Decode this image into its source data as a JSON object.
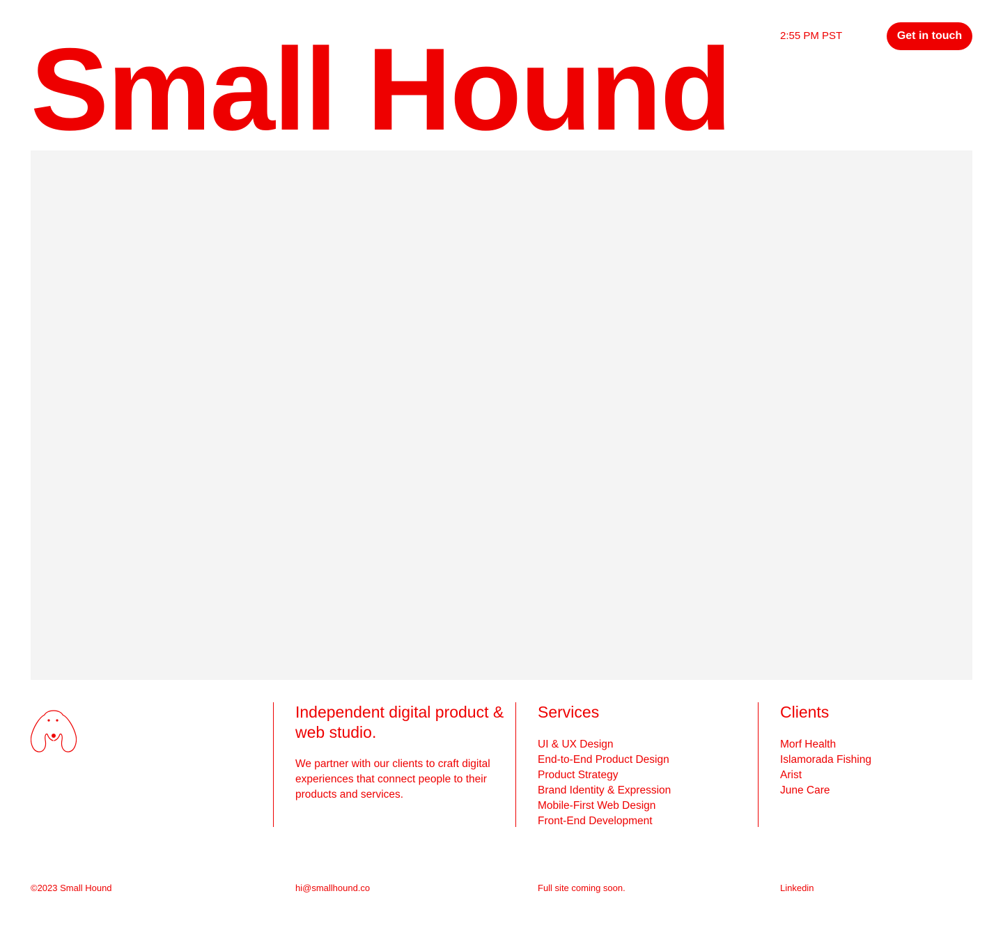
{
  "header": {
    "time": "2:55 PM PST",
    "cta_label": "Get in touch"
  },
  "brand": {
    "title": "Small Hound"
  },
  "hero": {
    "placeholder_color": "#f4f4f4"
  },
  "logo": {
    "icon": "dog-face-icon"
  },
  "about": {
    "heading": "Independent digital product & web studio.",
    "text": "We partner with our clients to craft digital experiences that connect people to their products and services."
  },
  "services": {
    "heading": "Services",
    "items": [
      "UI & UX Design",
      "End-to-End Product Design",
      "Product Strategy",
      "Brand Identity & Expression",
      "Mobile-First Web Design",
      "Front-End Development"
    ]
  },
  "clients": {
    "heading": "Clients",
    "items": [
      "Morf Health",
      "Islamorada Fishing",
      "Arist",
      "June Care"
    ]
  },
  "footer": {
    "copyright": "©2023 Small Hound",
    "email": "hi@smallhound.co",
    "note": "Full site coming soon.",
    "linkedin": "Linkedin"
  },
  "colors": {
    "accent": "#ee0000",
    "background": "#ffffff"
  }
}
